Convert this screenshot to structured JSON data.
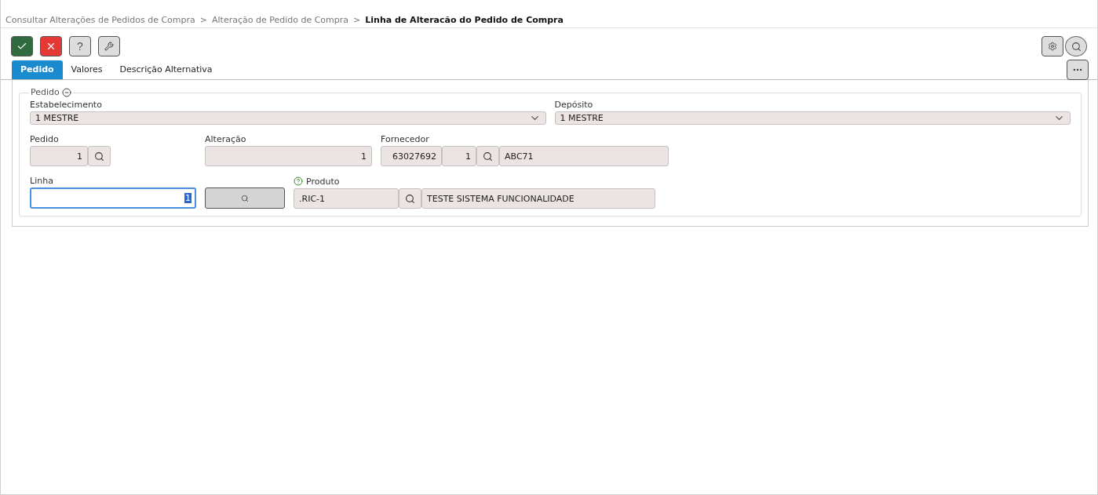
{
  "breadcrumb": [
    {
      "label": "Consultar Alterações de Pedidos de Compra",
      "current": false
    },
    {
      "label": "Alteração de Pedido de Compra",
      "current": false
    },
    {
      "label": "Linha de Alteracão do Pedido de Compra",
      "current": true
    }
  ],
  "breadcrumb_separator": ">",
  "help_button": "?",
  "tabs": [
    {
      "label": "Pedido",
      "selected": true
    },
    {
      "label": "Valores",
      "selected": false
    },
    {
      "label": "Descrição Alternativa",
      "selected": false
    }
  ],
  "section": {
    "title": "Pedido",
    "expanded": true,
    "selects": [
      {
        "label": "Estabelecimento",
        "value": "1 MESTRE"
      },
      {
        "label": "Depósito",
        "value": "1 MESTRE"
      }
    ],
    "pedido": {
      "label": "Pedido",
      "value": "1"
    },
    "alteracao": {
      "label": "Alteração",
      "value": "1"
    },
    "fornecedor": {
      "label": "Fornecedor",
      "code": "63027692",
      "branch": "1",
      "name": "ABC71"
    },
    "linha": {
      "label": "Linha",
      "value": "1",
      "focused": true
    },
    "produto": {
      "label": "Produto",
      "code": ".RIC-1",
      "name": "TESTE SISTEMA FUNCIONALIDADE"
    }
  }
}
